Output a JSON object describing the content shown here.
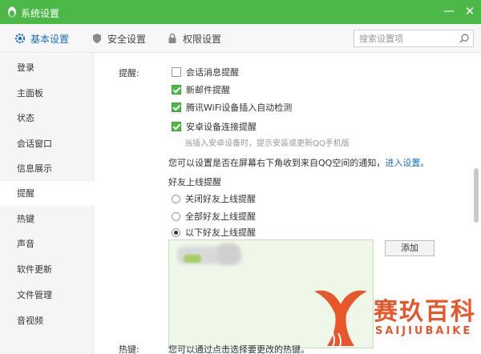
{
  "window": {
    "title": "系统设置",
    "minimize": "—",
    "close": "✕"
  },
  "tabs": [
    {
      "label": "基本设置",
      "icon": "gear-icon",
      "active": true
    },
    {
      "label": "安全设置",
      "icon": "shield-icon",
      "active": false
    },
    {
      "label": "权限设置",
      "icon": "lock-icon",
      "active": false
    }
  ],
  "search": {
    "placeholder": "搜索设置项",
    "icon": "search-icon"
  },
  "sidebar": {
    "items": [
      {
        "label": "登录"
      },
      {
        "label": "主面板"
      },
      {
        "label": "状态"
      },
      {
        "label": "会话窗口"
      },
      {
        "label": "信息展示"
      },
      {
        "label": "提醒",
        "active": true
      },
      {
        "label": "热键"
      },
      {
        "label": "声音"
      },
      {
        "label": "软件更新"
      },
      {
        "label": "文件管理"
      },
      {
        "label": "音视频"
      }
    ]
  },
  "content": {
    "reminder_label": "提醒:",
    "options": [
      {
        "label": "会话消息提醒",
        "checked": false
      },
      {
        "label": "新邮件提醒",
        "checked": true
      },
      {
        "label": "腾讯WiFi设备插入自动检测",
        "checked": true
      },
      {
        "label": "安卓设备连接提醒",
        "checked": true
      }
    ],
    "android_hint": "当插入安卓设备时，提示安装或更新QQ手机版",
    "notify_desc": "您可以设置是否在屏幕右下角收到来自QQ空间的通知，",
    "notify_link": "进入设置。",
    "friend_online_title": "好友上线提醒",
    "radios": [
      {
        "label": "关闭好友上线提醒",
        "selected": false
      },
      {
        "label": "全部好友上线提醒",
        "selected": false
      },
      {
        "label": "以下好友上线提醒",
        "selected": true
      }
    ],
    "add_button": "添加",
    "hotkey_label": "热键:",
    "hotkey_desc": "您可以通过点击选择要更改的热键。"
  },
  "watermark": {
    "text": "赛玖百科",
    "sub": "SAIJIUBAIKE"
  },
  "colors": {
    "titlebar": "#4cb847",
    "accent": "#1a6fbf",
    "watermark": "#e8572b"
  }
}
